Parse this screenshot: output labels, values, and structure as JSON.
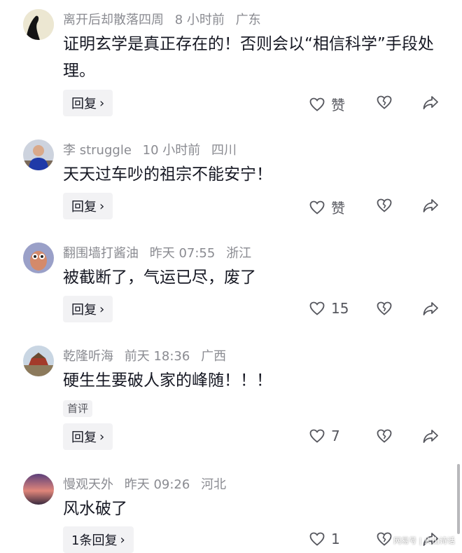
{
  "comments": [
    {
      "username": "离开后却散落四周",
      "time": "8 小时前",
      "location": "广东",
      "text": "证明玄学是真正存在的！否则会以“相信科学”手段处理。",
      "reply_label": "回复",
      "like_label": "赞",
      "avatar": "dark-silhouette"
    },
    {
      "username": "李 struggle",
      "time": "10 小时前",
      "location": "四川",
      "text": "天天过车吵的祖宗不能安宁！",
      "reply_label": "回复",
      "like_label": "赞",
      "avatar": "person-photo"
    },
    {
      "username": "翻围墙打酱油",
      "time": "昨天 07:55",
      "location": "浙江",
      "text": "被截断了，气运已尽，废了",
      "reply_label": "回复",
      "like_label": "15",
      "avatar": "cartoon-character"
    },
    {
      "username": "乾隆听海",
      "time": "前天 18:36",
      "location": "广西",
      "text": "硬生生要破人家的峰随！！！",
      "tag": "首评",
      "reply_label": "回复",
      "like_label": "7",
      "avatar": "palace-photo"
    },
    {
      "username": "慢观天外",
      "time": "昨天 09:26",
      "location": "河北",
      "text": "风水破了",
      "reply_label": "1条回复",
      "like_label": "1",
      "avatar": "sunset-photo"
    }
  ],
  "icons": {
    "like": "heart-outline-icon",
    "dislike": "broken-heart-icon",
    "share": "share-arrow-icon",
    "chevron": "chevron-right-icon"
  },
  "watermark": "网易号 | 火山诗话",
  "colors": {
    "text": "#161823",
    "meta": "#8a8b91",
    "button_bg": "#f2f2f4"
  }
}
